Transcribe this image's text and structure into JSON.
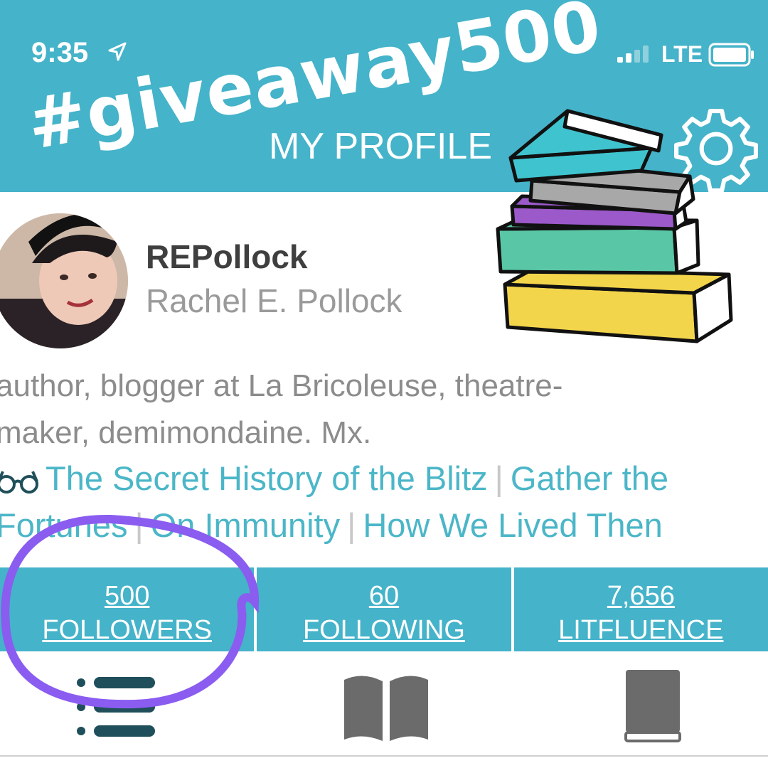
{
  "status_bar": {
    "time": "9:35",
    "network": "LTE"
  },
  "header": {
    "hashtag": "#giveaway500",
    "title": "MY PROFILE"
  },
  "profile": {
    "username": "REPollock",
    "full_name": "Rachel E. Pollock",
    "bio": [
      "author, blogger at La Bricoleuse, theatre-",
      "maker, demimondaine. Mx."
    ],
    "reading_links": [
      "The Secret History of the Blitz",
      "Gather the",
      "Fortunes",
      "On Immunity",
      "How We Lived Then"
    ]
  },
  "stats": [
    {
      "value": "500",
      "label": "FOLLOWERS"
    },
    {
      "value": "60",
      "label": "FOLLOWING"
    },
    {
      "value": "7,656",
      "label": "LITFLUENCE"
    }
  ],
  "tabs": [
    "list-view-icon",
    "open-book-icon",
    "closed-book-icon"
  ],
  "colors": {
    "teal": "#45b3c9",
    "link": "#4bb6c8",
    "annotation": "#8a5cf0"
  }
}
